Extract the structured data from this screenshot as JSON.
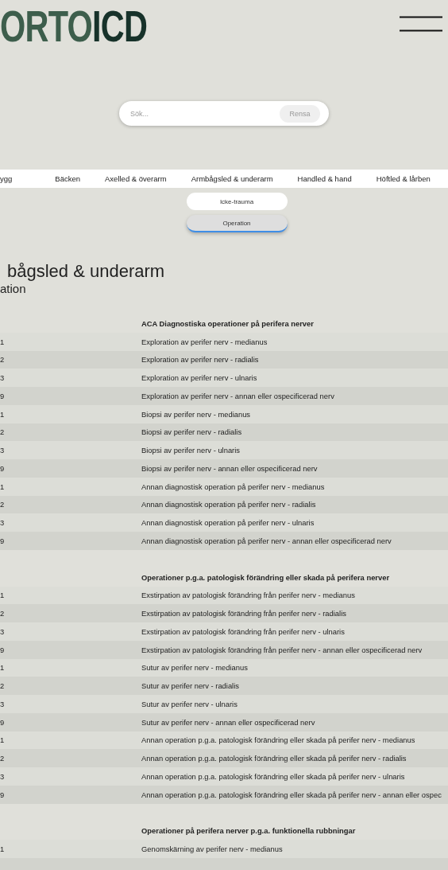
{
  "logo": {
    "part1": "ORTO",
    "part2": "ICD"
  },
  "search": {
    "placeholder": "Sök...",
    "clear_button": "Rensa"
  },
  "nav": [
    {
      "label": "ygg",
      "selected": false
    },
    {
      "label": "Bäcken",
      "selected": false
    },
    {
      "label": "Axelled & överarm",
      "selected": false
    },
    {
      "label": "Armbågsled & underarm",
      "selected": false
    },
    {
      "label": "Handled & hand",
      "selected": false
    },
    {
      "label": "Höftled & lårben",
      "selected": false
    }
  ],
  "subtabs": [
    {
      "label": "Icke-trauma",
      "selected": false
    },
    {
      "label": "Operation",
      "selected": true
    }
  ],
  "heading": "bågsled & underarm",
  "subheading": "ation",
  "sections": [
    {
      "title": "ACA Diagnostiska operationer på perifera nerver",
      "rows": [
        {
          "code": "1",
          "text": "Exploration av perifer nerv - medianus"
        },
        {
          "code": "2",
          "text": "Exploration av perifer nerv - radialis"
        },
        {
          "code": "3",
          "text": "Exploration av perifer nerv - ulnaris"
        },
        {
          "code": "9",
          "text": "Exploration av perifer nerv - annan eller ospecificerad nerv"
        },
        {
          "code": "1",
          "text": "Biopsi av perifer nerv - medianus"
        },
        {
          "code": "2",
          "text": "Biopsi av perifer nerv - radialis"
        },
        {
          "code": "3",
          "text": "Biopsi av perifer nerv - ulnaris"
        },
        {
          "code": "9",
          "text": "Biopsi av perifer nerv - annan eller ospecificerad nerv"
        },
        {
          "code": "1",
          "text": "Annan diagnostisk operation på perifer nerv - medianus"
        },
        {
          "code": "2",
          "text": "Annan diagnostisk operation på perifer nerv - radialis"
        },
        {
          "code": "3",
          "text": "Annan diagnostisk operation på perifer nerv - ulnaris"
        },
        {
          "code": "9",
          "text": "Annan diagnostisk operation på perifer nerv - annan eller ospecificerad nerv"
        }
      ]
    },
    {
      "title": "Operationer p.g.a. patologisk förändring eller skada på perifera nerver",
      "rows": [
        {
          "code": "1",
          "text": "Exstirpation av patologisk förändring från perifer nerv - medianus"
        },
        {
          "code": "2",
          "text": "Exstirpation av patologisk förändring från perifer nerv - radialis"
        },
        {
          "code": "3",
          "text": "Exstirpation av patologisk förändring från perifer nerv - ulnaris"
        },
        {
          "code": "9",
          "text": "Exstirpation av patologisk förändring från perifer nerv - annan eller ospecificerad nerv"
        },
        {
          "code": "1",
          "text": "Sutur av perifer nerv - medianus"
        },
        {
          "code": "2",
          "text": "Sutur av perifer nerv - radialis"
        },
        {
          "code": "3",
          "text": "Sutur av perifer nerv - ulnaris"
        },
        {
          "code": "9",
          "text": "Sutur av perifer nerv - annan eller ospecificerad nerv"
        },
        {
          "code": "1",
          "text": "Annan operation p.g.a. patologisk förändring eller skada på perifer nerv - medianus"
        },
        {
          "code": "2",
          "text": "Annan operation p.g.a. patologisk förändring eller skada på perifer nerv - radialis"
        },
        {
          "code": "3",
          "text": "Annan operation p.g.a. patologisk förändring eller skada på perifer nerv - ulnaris"
        },
        {
          "code": "9",
          "text": "Annan operation p.g.a. patologisk förändring eller skada på perifer nerv - annan eller ospec"
        }
      ]
    },
    {
      "title": "Operationer på perifera nerver p.g.a. funktionella rubbningar",
      "rows": [
        {
          "code": "1",
          "text": "Genomskärning av perifer nerv - medianus"
        }
      ]
    }
  ]
}
